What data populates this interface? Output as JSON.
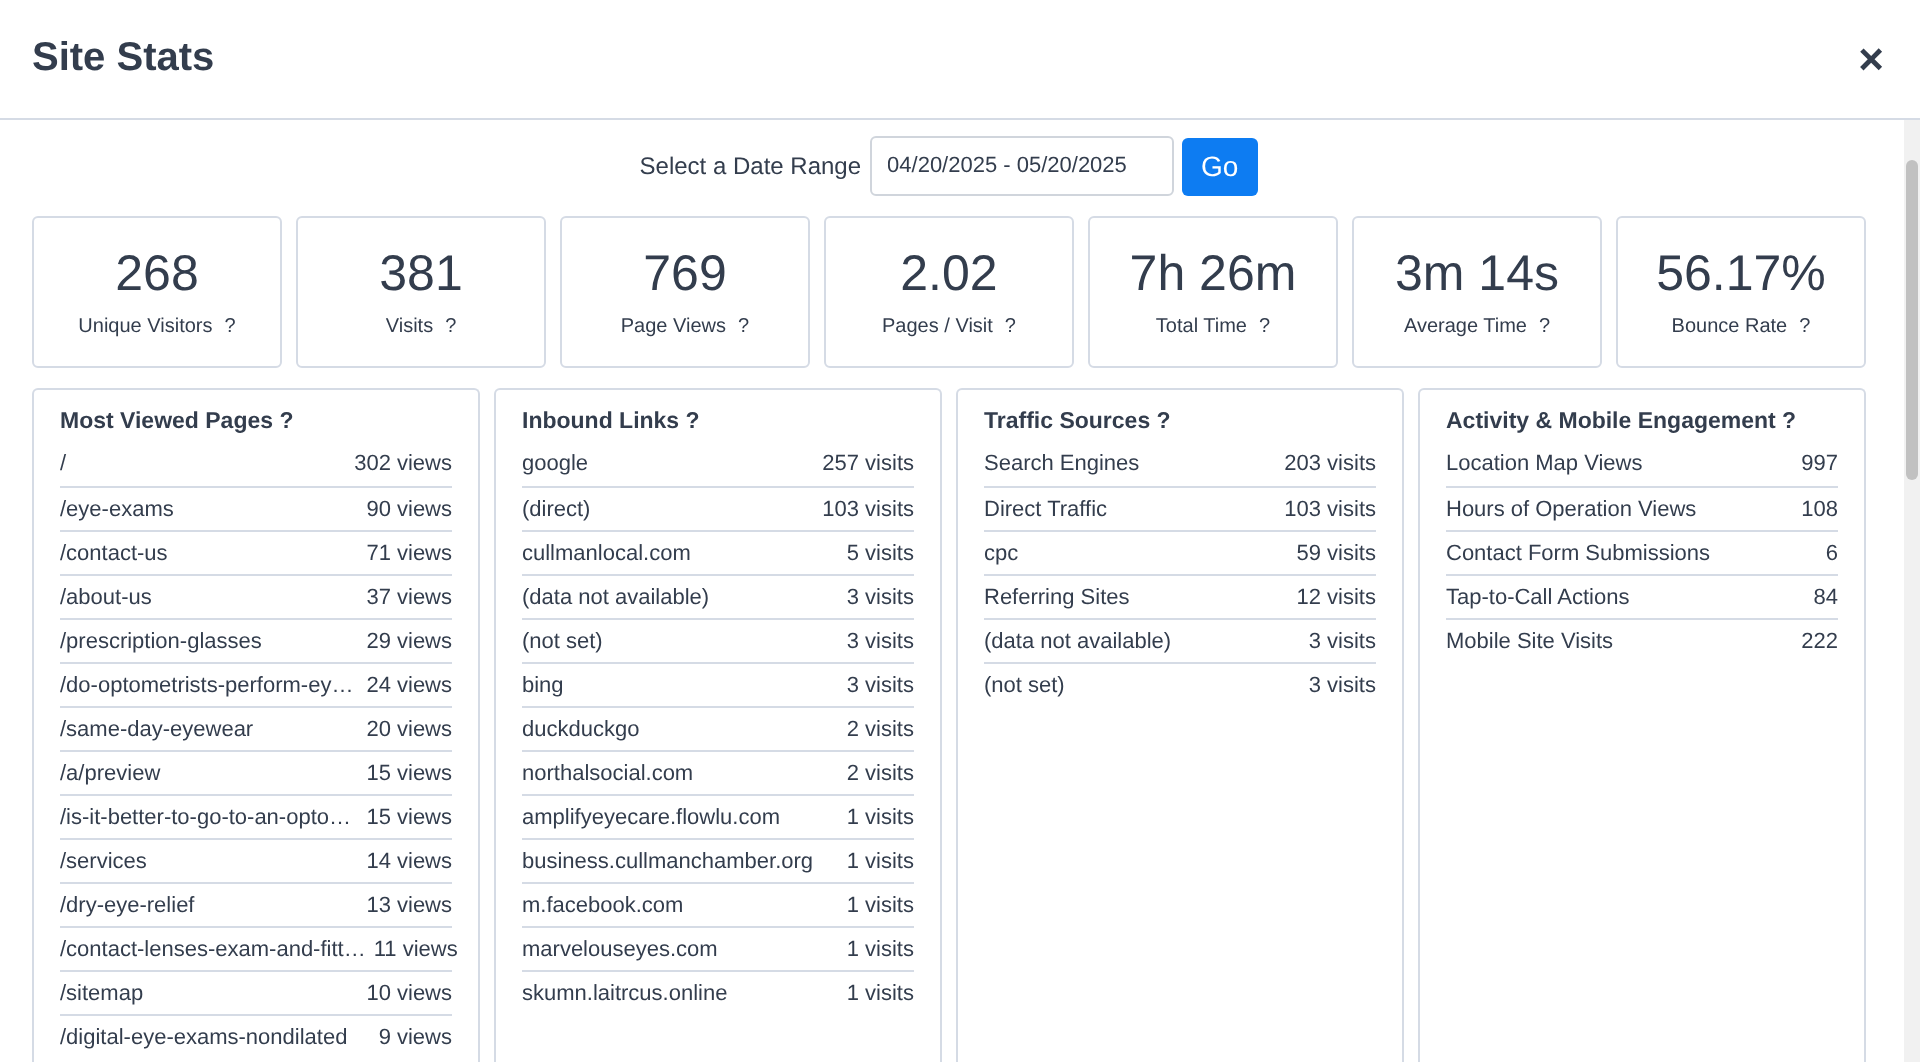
{
  "window": {
    "title": "Site Stats",
    "close": "×"
  },
  "date_range": {
    "label": "Select a Date Range",
    "value": "04/20/2025 - 05/20/2025",
    "button": "Go"
  },
  "stats": [
    {
      "value": "268",
      "label": "Unique Visitors",
      "help": "?"
    },
    {
      "value": "381",
      "label": "Visits",
      "help": "?"
    },
    {
      "value": "769",
      "label": "Page Views",
      "help": "?"
    },
    {
      "value": "2.02",
      "label": "Pages / Visit",
      "help": "?"
    },
    {
      "value": "7h 26m",
      "label": "Total Time",
      "help": "?"
    },
    {
      "value": "3m 14s",
      "label": "Average Time",
      "help": "?"
    },
    {
      "value": "56.17%",
      "label": "Bounce Rate",
      "help": "?"
    }
  ],
  "panels": [
    {
      "title": "Most Viewed Pages ?",
      "rows": [
        {
          "name": "/",
          "count": "302 views"
        },
        {
          "name": "/eye-exams",
          "count": "90 views"
        },
        {
          "name": "/contact-us",
          "count": "71 views"
        },
        {
          "name": "/about-us",
          "count": "37 views"
        },
        {
          "name": "/prescription-glasses",
          "count": "29 views"
        },
        {
          "name": "/do-optometrists-perform-ey…",
          "count": "24 views"
        },
        {
          "name": "/same-day-eyewear",
          "count": "20 views"
        },
        {
          "name": "/a/preview",
          "count": "15 views"
        },
        {
          "name": "/is-it-better-to-go-to-an-opto…",
          "count": "15 views"
        },
        {
          "name": "/services",
          "count": "14 views"
        },
        {
          "name": "/dry-eye-relief",
          "count": "13 views"
        },
        {
          "name": "/contact-lenses-exam-and-fitt…",
          "count": "11 views"
        },
        {
          "name": "/sitemap",
          "count": "10 views"
        },
        {
          "name": "/digital-eye-exams-nondilated",
          "count": "9 views"
        }
      ]
    },
    {
      "title": "Inbound Links ?",
      "rows": [
        {
          "name": "google",
          "count": "257 visits"
        },
        {
          "name": "(direct)",
          "count": "103 visits"
        },
        {
          "name": "cullmanlocal.com",
          "count": "5 visits"
        },
        {
          "name": "(data not available)",
          "count": "3 visits"
        },
        {
          "name": "(not set)",
          "count": "3 visits"
        },
        {
          "name": "bing",
          "count": "3 visits"
        },
        {
          "name": "duckduckgo",
          "count": "2 visits"
        },
        {
          "name": "northalsocial.com",
          "count": "2 visits"
        },
        {
          "name": "amplifyeyecare.flowlu.com",
          "count": "1 visits"
        },
        {
          "name": "business.cullmanchamber.org",
          "count": "1 visits"
        },
        {
          "name": "m.facebook.com",
          "count": "1 visits"
        },
        {
          "name": "marvelouseyes.com",
          "count": "1 visits"
        },
        {
          "name": "skumn.laitrcus.online",
          "count": "1 visits"
        }
      ]
    },
    {
      "title": "Traffic Sources ?",
      "rows": [
        {
          "name": "Search Engines",
          "count": "203 visits"
        },
        {
          "name": "Direct Traffic",
          "count": "103 visits"
        },
        {
          "name": "cpc",
          "count": "59 visits"
        },
        {
          "name": "Referring Sites",
          "count": "12 visits"
        },
        {
          "name": "(data not available)",
          "count": "3 visits"
        },
        {
          "name": "(not set)",
          "count": "3 visits"
        }
      ]
    },
    {
      "title": "Activity & Mobile Engagement ?",
      "rows": [
        {
          "name": "Location Map Views",
          "count": "997"
        },
        {
          "name": "Hours of Operation Views",
          "count": "108"
        },
        {
          "name": "Contact Form Submissions",
          "count": "6"
        },
        {
          "name": "Tap-to-Call Actions",
          "count": "84"
        },
        {
          "name": "Mobile Site Visits",
          "count": "222"
        }
      ]
    }
  ]
}
